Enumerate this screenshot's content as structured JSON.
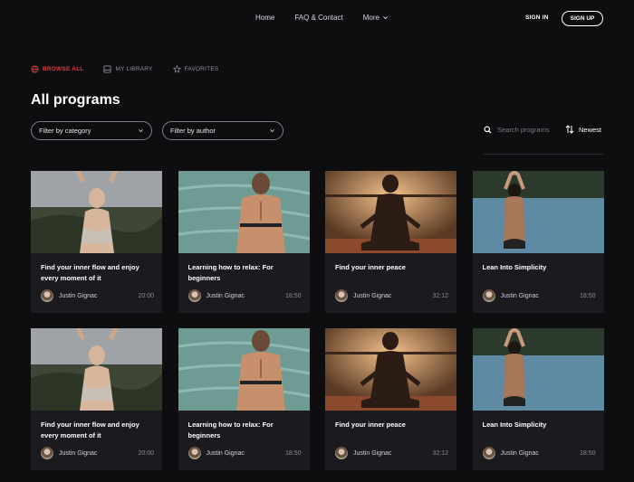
{
  "nav": {
    "links": [
      "Home",
      "FAQ & Contact",
      "More"
    ],
    "sign_in": "SIGN IN",
    "sign_up": "SIGN UP"
  },
  "tabs": [
    {
      "label": "BROWSE ALL",
      "icon": "globe-icon",
      "active": true
    },
    {
      "label": "MY LIBRARY",
      "icon": "library-icon",
      "active": false
    },
    {
      "label": "FAVORITES",
      "icon": "star-icon",
      "active": false
    }
  ],
  "page_title": "All programs",
  "filters": {
    "category": "Filter by category",
    "author": "Filter by author",
    "search_placeholder": "Search programs",
    "sort": "Newest"
  },
  "colors": {
    "accent": "#e8383f",
    "background": "#0e0e11",
    "card": "#1a1a1f"
  },
  "programs": [
    {
      "title": "Find your inner flow and enjoy every moment of it",
      "author": "Justin Gignac",
      "duration": "20:00",
      "image": "woman-arms-raised-outdoors"
    },
    {
      "title": "Learning how to relax: For beginners",
      "author": "Justin Gignac",
      "duration": "18:50",
      "image": "woman-back-by-sea"
    },
    {
      "title": "Find your inner peace",
      "author": "Justin Gignac",
      "duration": "32:12",
      "image": "meditation-silhouette-sunset"
    },
    {
      "title": "Lean Into Simplicity",
      "author": "Justin Gignac",
      "duration": "18:50",
      "image": "woman-in-infinity-pool"
    },
    {
      "title": "Find your inner flow and enjoy every moment of it",
      "author": "Justin Gignac",
      "duration": "20:00",
      "image": "woman-arms-raised-outdoors"
    },
    {
      "title": "Learning how to relax: For beginners",
      "author": "Justin Gignac",
      "duration": "18:50",
      "image": "woman-back-by-sea"
    },
    {
      "title": "Find your inner peace",
      "author": "Justin Gignac",
      "duration": "32:12",
      "image": "meditation-silhouette-sunset"
    },
    {
      "title": "Lean Into Simplicity",
      "author": "Justin Gignac",
      "duration": "18:50",
      "image": "woman-in-infinity-pool"
    }
  ]
}
